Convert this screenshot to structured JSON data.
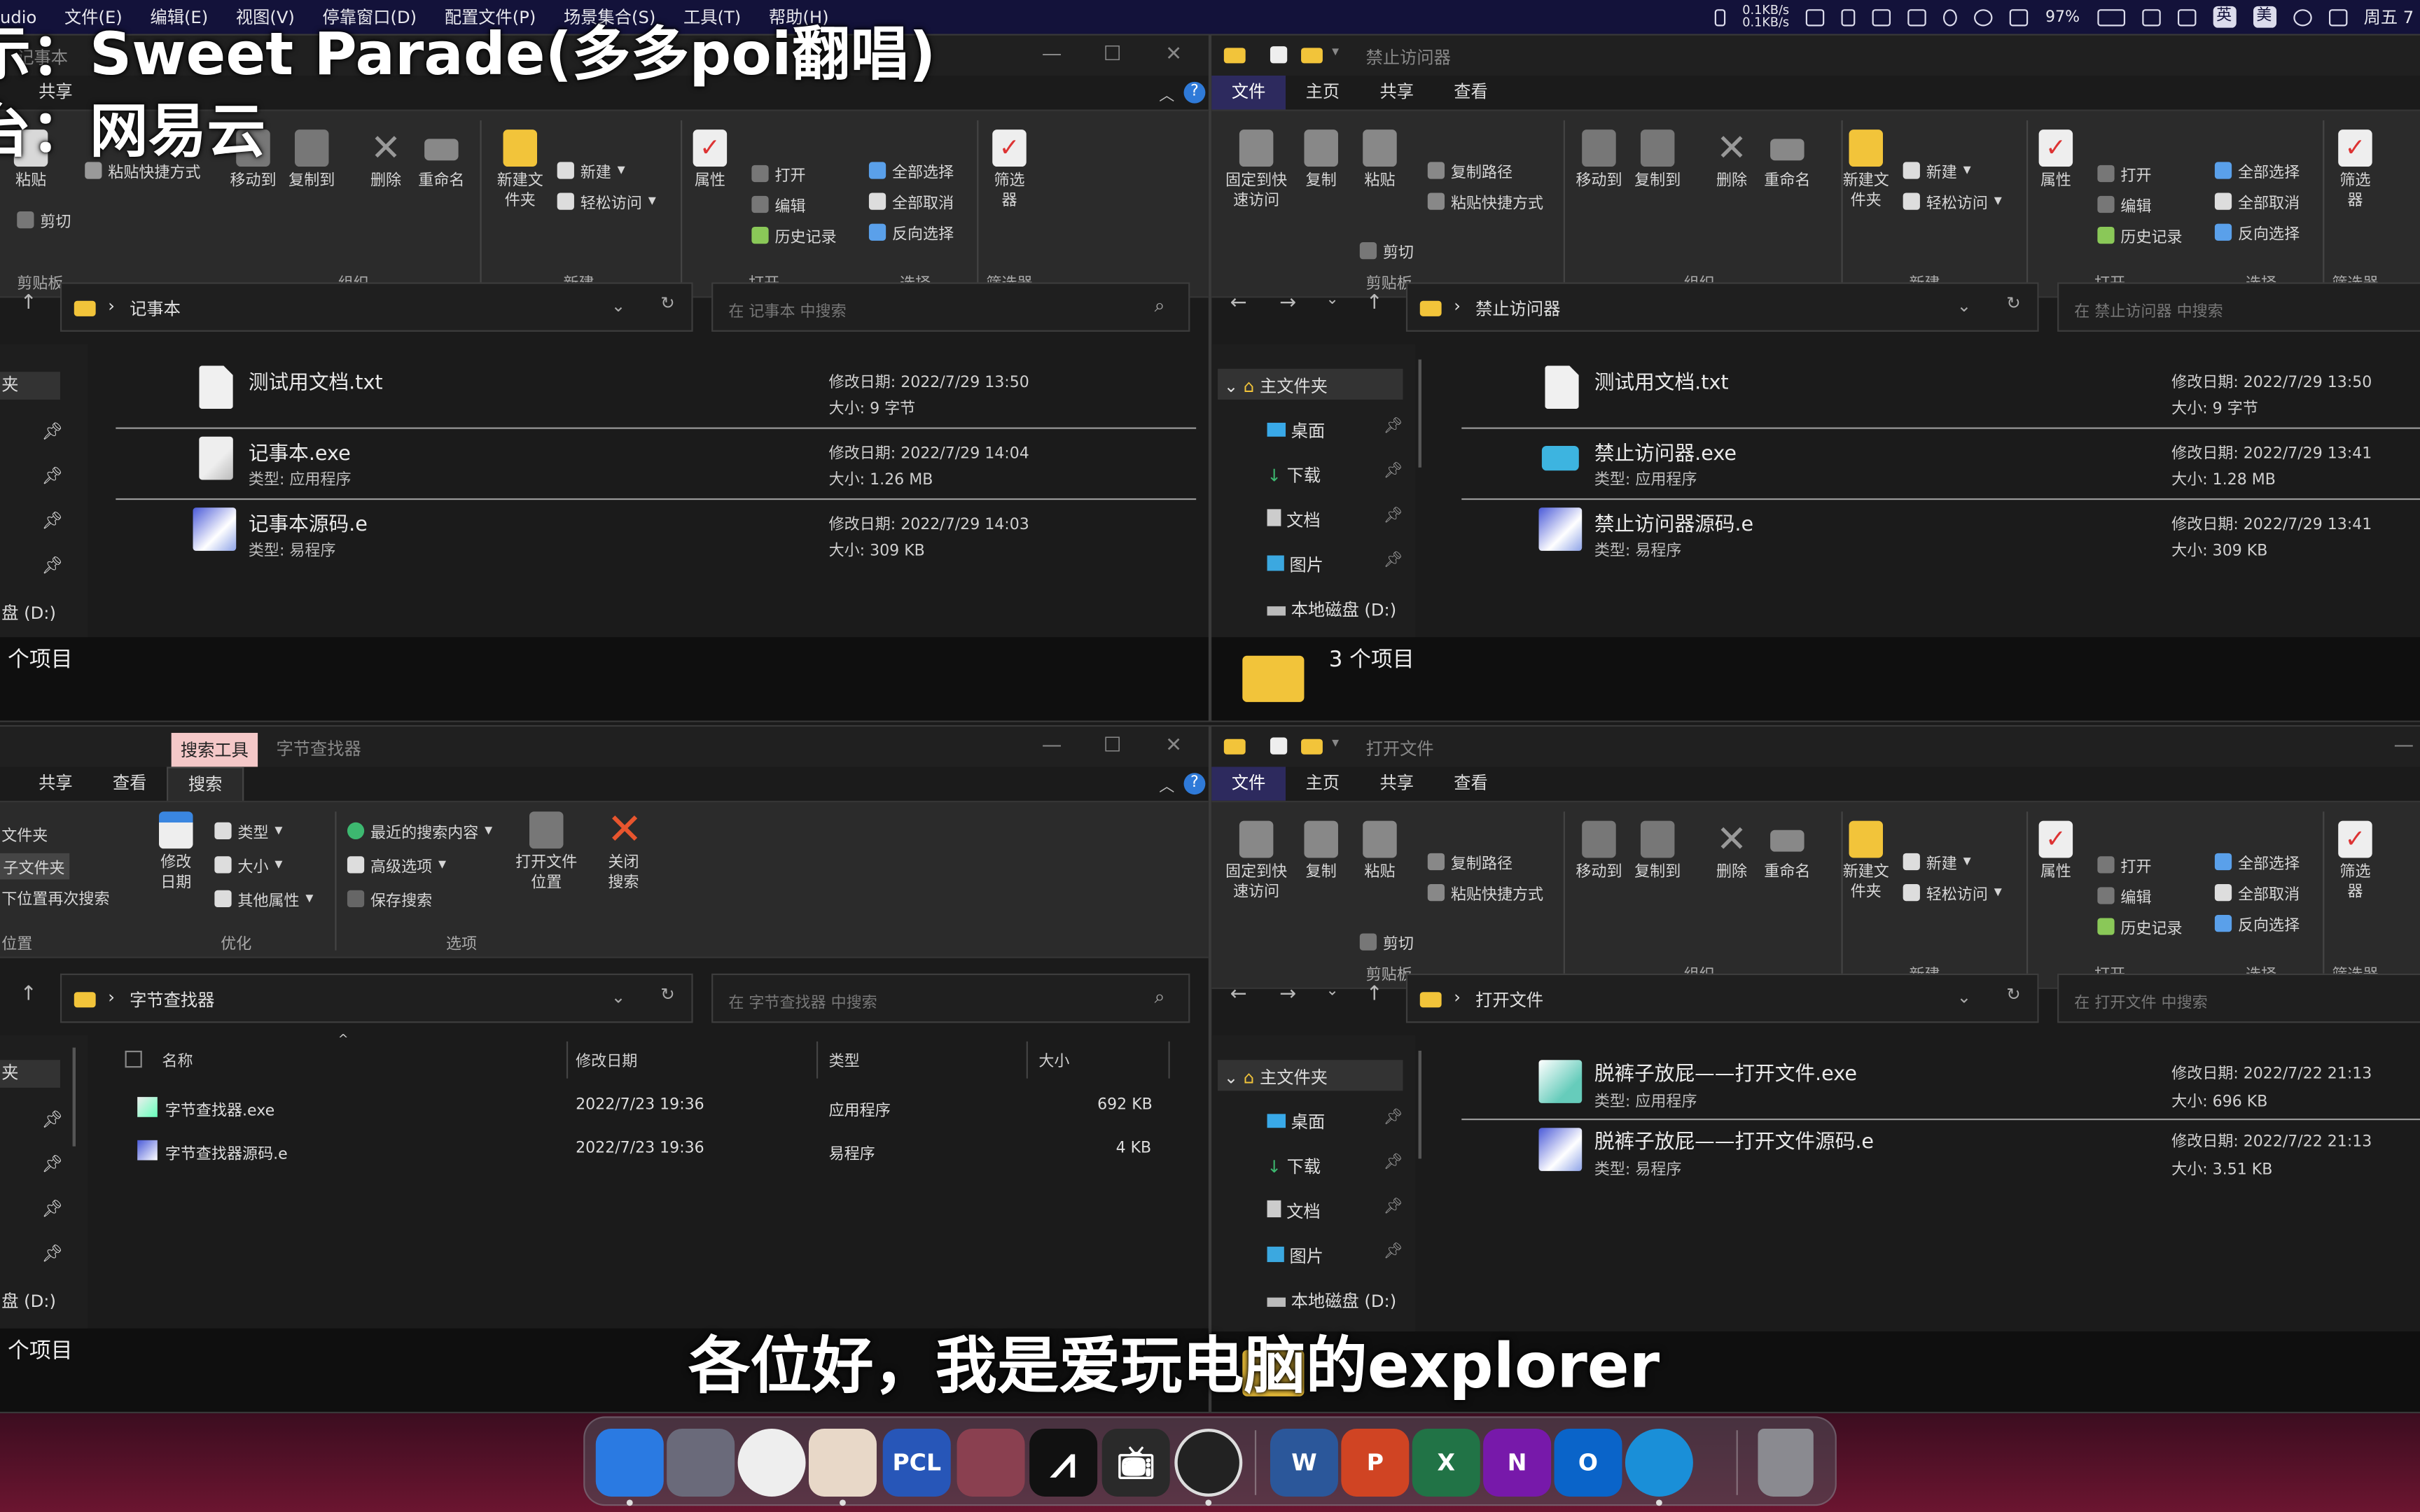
{
  "menubar": {
    "app": "udio",
    "items": [
      "文件(E)",
      "编辑(E)",
      "视图(V)",
      "停靠窗口(D)",
      "配置文件(P)",
      "场景集合(S)",
      "工具(T)",
      "帮助(H)"
    ],
    "net_up": "0.1KB/s",
    "net_down": "0.1KB/s",
    "battery": "97%",
    "ime1": "英",
    "ime2": "美",
    "clock": "周五 7"
  },
  "overlay": {
    "song_line": "示：Sweet Parade(多多poi翻唱)",
    "platform_line": "台：网易云",
    "subtitle": "各位好，我是爱玩电脑的explorer"
  },
  "ribbon_labels": {
    "paste": "粘贴",
    "paste_shortcut": "粘贴快捷方式",
    "cut": "剪切",
    "copy_path": "复制路径",
    "pin": "固定到快速访问",
    "copy": "复制",
    "move_to": "移动到",
    "copy_to": "复制到",
    "delete": "删除",
    "rename": "重命名",
    "new_folder": "新建文件夹",
    "new": "新建",
    "easy_access": "轻松访问",
    "properties": "属性",
    "open": "打开",
    "edit": "编辑",
    "history": "历史记录",
    "select_all": "全部选择",
    "select_none": "全部取消",
    "invert": "反向选择",
    "filter": "筛选器",
    "g_clipboard": "剪贴板",
    "g_organize": "组织",
    "g_new": "新建",
    "g_open": "打开",
    "g_select": "选择",
    "g_filter": "筛选器"
  },
  "tabs": {
    "file": "文件",
    "home": "主页",
    "share": "共享",
    "view": "查看",
    "search_tools": "搜索工具",
    "search": "搜索"
  },
  "tree": {
    "home": "主文件夹",
    "desktop": "桌面",
    "downloads": "下载",
    "documents": "文档",
    "pictures": "图片",
    "disk": "本地磁盘 (D:)",
    "disk_cut": "盘 (D:)",
    "quick": "夹"
  },
  "win_notepad": {
    "title": "记事本",
    "address": "记事本",
    "search_placeholder": "在 记事本 中搜索",
    "status": "个项目",
    "files": [
      {
        "name": "测试用文档.txt",
        "type": "",
        "date": "修改日期: 2022/7/29 13:50",
        "size": "大小: 9 字节",
        "icon": "doc"
      },
      {
        "name": "记事本.exe",
        "type": "类型: 应用程序",
        "date": "修改日期: 2022/7/29 14:04",
        "size": "大小: 1.26 MB",
        "icon": "exe"
      },
      {
        "name": "记事本源码.e",
        "type": "类型: 易程序",
        "date": "修改日期: 2022/7/29 14:03",
        "size": "大小: 309 KB",
        "icon": "eprog"
      }
    ]
  },
  "win_block": {
    "title": "禁止访问器",
    "address": "禁止访问器",
    "search_placeholder": "在 禁止访问器 中搜索",
    "status": "3 个项目",
    "files": [
      {
        "name": "测试用文档.txt",
        "type": "",
        "date": "修改日期: 2022/7/29 13:50",
        "size": "大小: 9 字节",
        "icon": "doc"
      },
      {
        "name": "禁止访问器.exe",
        "type": "类型: 应用程序",
        "date": "修改日期: 2022/7/29 13:41",
        "size": "大小: 1.28 MB",
        "icon": "exe"
      },
      {
        "name": "禁止访问器源码.e",
        "type": "类型: 易程序",
        "date": "修改日期: 2022/7/29 13:41",
        "size": "大小: 309 KB",
        "icon": "eprog"
      }
    ]
  },
  "win_bytes": {
    "title": "字节查找器",
    "address": "字节查找器",
    "search_placeholder": "在 字节查找器 中搜索",
    "status": "个项目",
    "search_ribbon": {
      "subfolders1": "文件夹",
      "subfolders2": "子文件夹",
      "search_again": "下位置再次搜索",
      "location": "位置",
      "modified": "修改日期",
      "kind": "类型",
      "size": "大小",
      "other": "其他属性",
      "recent": "最近的搜索内容",
      "advanced": "高级选项",
      "save": "保存搜索",
      "open_loc": "打开文件位置",
      "close_search": "关闭搜索",
      "g_refine": "优化",
      "g_options": "选项"
    },
    "columns": [
      "名称",
      "修改日期",
      "类型",
      "大小"
    ],
    "rows": [
      {
        "name": "字节查找器.exe",
        "date": "2022/7/23 19:36",
        "type": "应用程序",
        "size": "692 KB"
      },
      {
        "name": "字节查找器源码.e",
        "date": "2022/7/23 19:36",
        "type": "易程序",
        "size": "4 KB"
      }
    ]
  },
  "win_open": {
    "title": "打开文件",
    "address": "打开文件",
    "search_placeholder": "在 打开文件 中搜索",
    "files": [
      {
        "name": "脱裤子放屁——打开文件.exe",
        "type": "类型: 应用程序",
        "date": "修改日期: 2022/7/22 21:13",
        "size": "大小: 696 KB",
        "icon": "exe"
      },
      {
        "name": "脱裤子放屁——打开文件源码.e",
        "type": "类型: 易程序",
        "date": "修改日期: 2022/7/22 21:13",
        "size": "大小: 3.51 KB",
        "icon": "eprog"
      }
    ]
  },
  "dock": [
    {
      "name": "finder",
      "label": "",
      "color": "#2a7ae2"
    },
    {
      "name": "launchpad",
      "label": "",
      "color": "#6a6a7a"
    },
    {
      "name": "clock",
      "label": "",
      "color": "#eeeeee"
    },
    {
      "name": "anime-app",
      "label": "",
      "color": "#e8d8c8"
    },
    {
      "name": "pcl",
      "label": "PCL",
      "color": "#2756b8"
    },
    {
      "name": "vpn",
      "label": "",
      "color": "#8a4050"
    },
    {
      "name": "capcut",
      "label": "",
      "color": "#111111"
    },
    {
      "name": "bilibili",
      "label": "",
      "color": "#2a2a2a"
    },
    {
      "name": "obs",
      "label": "",
      "color": "#222222"
    },
    {
      "name": "word",
      "label": "W",
      "color": "#2b579a"
    },
    {
      "name": "powerpoint",
      "label": "P",
      "color": "#d04423"
    },
    {
      "name": "excel",
      "label": "X",
      "color": "#217346"
    },
    {
      "name": "onenote",
      "label": "N",
      "color": "#7719aa"
    },
    {
      "name": "outlook",
      "label": "O",
      "color": "#0a64c9"
    },
    {
      "name": "edge",
      "label": "",
      "color": "#1a8fd8"
    },
    {
      "name": "trash",
      "label": "",
      "color": "#8a8a90"
    }
  ]
}
